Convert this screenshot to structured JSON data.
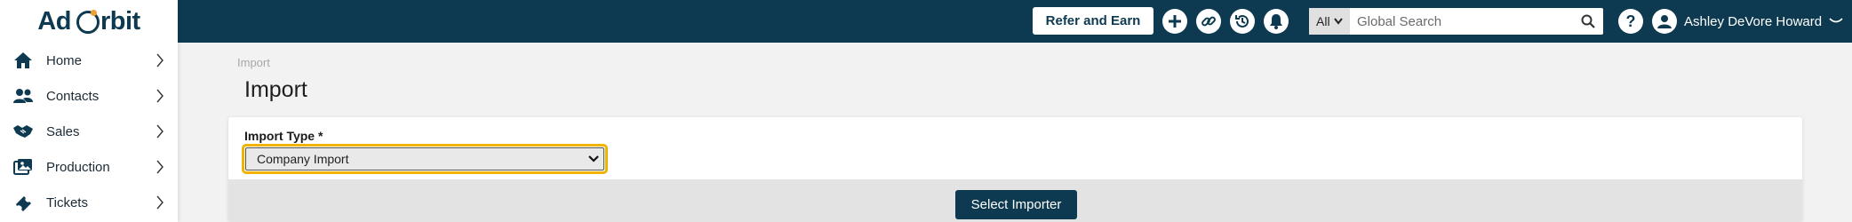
{
  "app": {
    "logo_text_left": "Ad",
    "logo_text_right": "rbit"
  },
  "sidebar": {
    "items": [
      {
        "label": "Home",
        "icon": "home-icon"
      },
      {
        "label": "Contacts",
        "icon": "contacts-icon"
      },
      {
        "label": "Sales",
        "icon": "handshake-icon"
      },
      {
        "label": "Production",
        "icon": "production-icon"
      },
      {
        "label": "Tickets",
        "icon": "ticket-icon"
      }
    ]
  },
  "header": {
    "refer_label": "Refer and Earn",
    "icons": [
      "add-icon",
      "link-icon",
      "history-icon",
      "bell-icon"
    ],
    "search": {
      "scope": "All",
      "placeholder": "Global Search",
      "value": ""
    },
    "help_icon": "help-icon",
    "user_name": "Ashley DeVore Howard"
  },
  "main": {
    "breadcrumb": "Import",
    "title": "Import",
    "import_type_label": "Import Type *",
    "import_type_value": "Company Import",
    "select_button_label": "Select Importer"
  },
  "colors": {
    "brand_navy": "#0d3a50",
    "focus_outline": "#f0b400",
    "accent_orange": "#f0a030",
    "page_bg": "#f2f2f2"
  }
}
